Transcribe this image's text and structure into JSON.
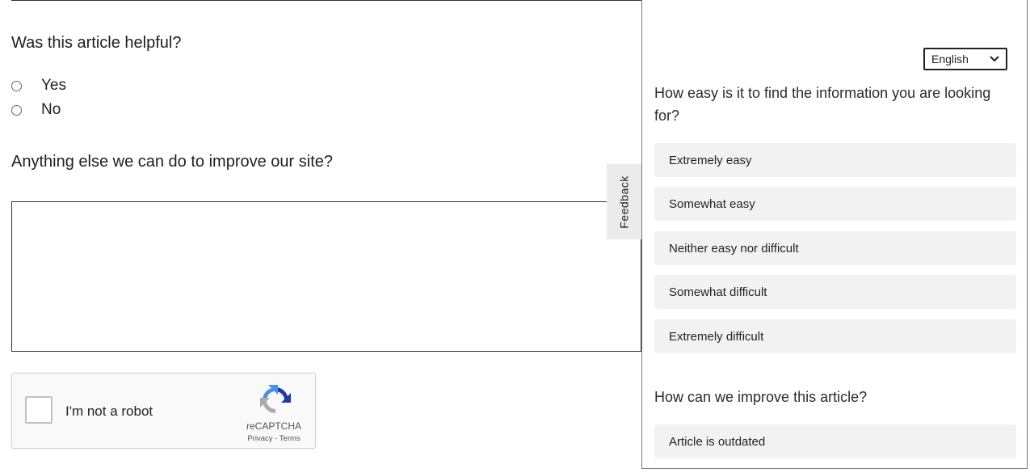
{
  "article": {
    "helpful_question": "Was this article helpful?",
    "options": [
      {
        "label": "Yes"
      },
      {
        "label": "No"
      }
    ],
    "improve_question": "Anything else we can do to improve our site?",
    "improve_value": ""
  },
  "recaptcha": {
    "label": "I'm not a robot",
    "brand": "reCAPTCHA",
    "privacy": "Privacy",
    "separator": " - ",
    "terms": "Terms"
  },
  "feedback_tab": {
    "label": "Feedback"
  },
  "survey": {
    "language": "English",
    "question1": "How easy is it to find the information you are looking for?",
    "options1": [
      {
        "label": "Extremely easy"
      },
      {
        "label": "Somewhat easy"
      },
      {
        "label": "Neither easy nor difficult"
      },
      {
        "label": "Somewhat difficult"
      },
      {
        "label": "Extremely difficult"
      }
    ],
    "question2": "How can we improve this article?",
    "options2": [
      {
        "label": "Article is outdated"
      }
    ]
  }
}
